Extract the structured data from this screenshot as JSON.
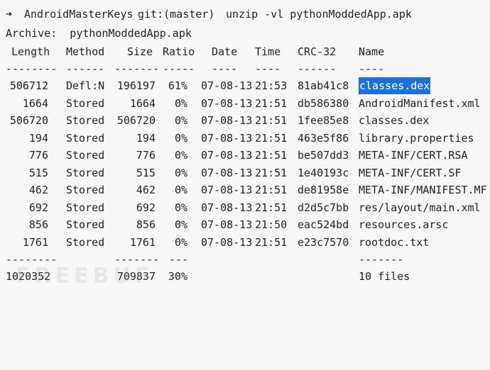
{
  "prompt": {
    "arrow": "➜",
    "dir": "AndroidMasterKeys",
    "git": "git:(master)",
    "command": "unzip -vl pythonModdedApp.apk"
  },
  "archive_line": "Archive:  pythonModdedApp.apk",
  "headers": [
    "Length",
    "Method",
    "Size",
    "Ratio",
    "Date",
    "Time",
    "CRC-32",
    "Name"
  ],
  "header_rule": [
    "--------",
    "------",
    "-------",
    "-----",
    "----",
    "----",
    "------",
    "----"
  ],
  "files": [
    {
      "length": "506712",
      "method": "Defl:N",
      "size": "196197",
      "ratio": "61%",
      "date": "07-08-13",
      "time": "21:53",
      "crc": "81ab41c8",
      "name": "classes.dex",
      "selected": true
    },
    {
      "length": "1664",
      "method": "Stored",
      "size": "1664",
      "ratio": "0%",
      "date": "07-08-13",
      "time": "21:51",
      "crc": "db586380",
      "name": "AndroidManifest.xml"
    },
    {
      "length": "506720",
      "method": "Stored",
      "size": "506720",
      "ratio": "0%",
      "date": "07-08-13",
      "time": "21:51",
      "crc": "1fee85e8",
      "name": "classes.dex"
    },
    {
      "length": "194",
      "method": "Stored",
      "size": "194",
      "ratio": "0%",
      "date": "07-08-13",
      "time": "21:51",
      "crc": "463e5f86",
      "name": "library.properties"
    },
    {
      "length": "776",
      "method": "Stored",
      "size": "776",
      "ratio": "0%",
      "date": "07-08-13",
      "time": "21:51",
      "crc": "be507dd3",
      "name": "META-INF/CERT.RSA"
    },
    {
      "length": "515",
      "method": "Stored",
      "size": "515",
      "ratio": "0%",
      "date": "07-08-13",
      "time": "21:51",
      "crc": "1e40193c",
      "name": "META-INF/CERT.SF"
    },
    {
      "length": "462",
      "method": "Stored",
      "size": "462",
      "ratio": "0%",
      "date": "07-08-13",
      "time": "21:51",
      "crc": "de81958e",
      "name": "META-INF/MANIFEST.MF"
    },
    {
      "length": "692",
      "method": "Stored",
      "size": "692",
      "ratio": "0%",
      "date": "07-08-13",
      "time": "21:51",
      "crc": "d2d5c7bb",
      "name": "res/layout/main.xml"
    },
    {
      "length": "856",
      "method": "Stored",
      "size": "856",
      "ratio": "0%",
      "date": "07-08-13",
      "time": "21:50",
      "crc": "eac524bd",
      "name": "resources.arsc"
    },
    {
      "length": "1761",
      "method": "Stored",
      "size": "1761",
      "ratio": "0%",
      "date": "07-08-13",
      "time": "21:51",
      "crc": "e23c7570",
      "name": "rootdoc.txt"
    }
  ],
  "footer_rule": {
    "length": "--------",
    "size": "-------",
    "ratio": "---",
    "name": "-------"
  },
  "totals": {
    "length": "1020352",
    "size": "709837",
    "ratio": "30%",
    "name": "10 files"
  },
  "watermark": "FREEBUF",
  "colors": {
    "background": "#f7f7f7",
    "text": "#222222",
    "selection": "#1f6fd6"
  }
}
